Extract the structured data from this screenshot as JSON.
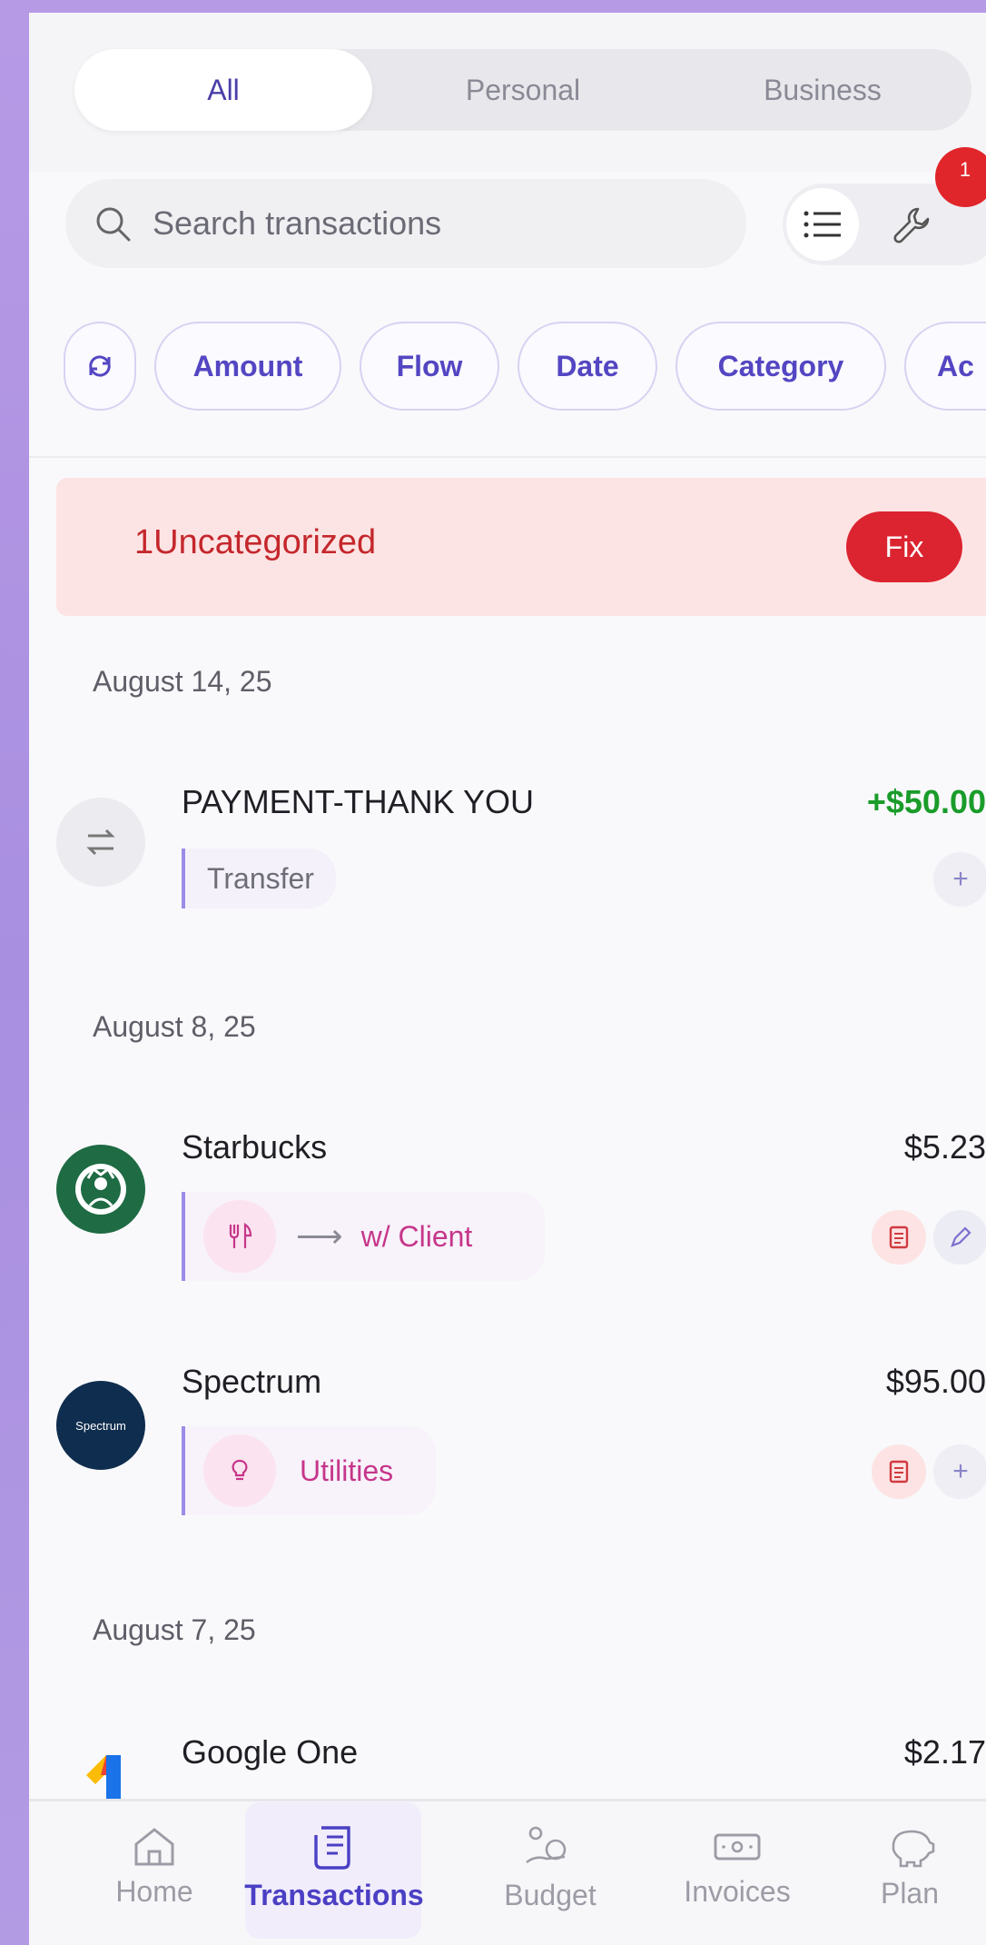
{
  "segment": {
    "options": [
      "All",
      "Personal",
      "Business"
    ],
    "selected": "All"
  },
  "search": {
    "placeholder": "Search transactions",
    "icon": "search-icon"
  },
  "tools": {
    "list_icon": "list-icon",
    "wrench_icon": "wrench-icon",
    "badge_count": "1"
  },
  "filters": [
    "Amount",
    "Flow",
    "Date",
    "Category",
    "Ac"
  ],
  "alert": {
    "count": "1",
    "text": "Uncategorized",
    "fix_label": "Fix"
  },
  "groups": [
    {
      "date": "August 14, 25"
    },
    {
      "date": "August 8, 25"
    },
    {
      "date": "August 7, 25"
    }
  ],
  "transactions": [
    {
      "name": "PAYMENT-THANK YOU",
      "amount": "+$50.00",
      "category": "Transfer"
    },
    {
      "name": "Starbucks",
      "amount": "$5.23",
      "category_arrow": "⟶",
      "category": "w/ Client"
    },
    {
      "name": "Spectrum",
      "amount": "$95.00",
      "category": "Utilities",
      "logo_text": "Spectrum"
    },
    {
      "name": "Google One",
      "amount": "$2.17"
    }
  ],
  "nav": [
    {
      "label": "Home",
      "icon": "home-icon"
    },
    {
      "label": "Transactions",
      "icon": "receipt-icon",
      "active": true
    },
    {
      "label": "Budget",
      "icon": "budget-icon"
    },
    {
      "label": "Invoices",
      "icon": "cash-icon"
    },
    {
      "label": "Plan",
      "icon": "piggy-bank-icon"
    }
  ],
  "colors": {
    "accent": "#4b3fc4",
    "alert_bg": "#fde4e4",
    "alert_red": "#db2430",
    "positive": "#1a9c2a",
    "category_pink": "#c6368a"
  }
}
